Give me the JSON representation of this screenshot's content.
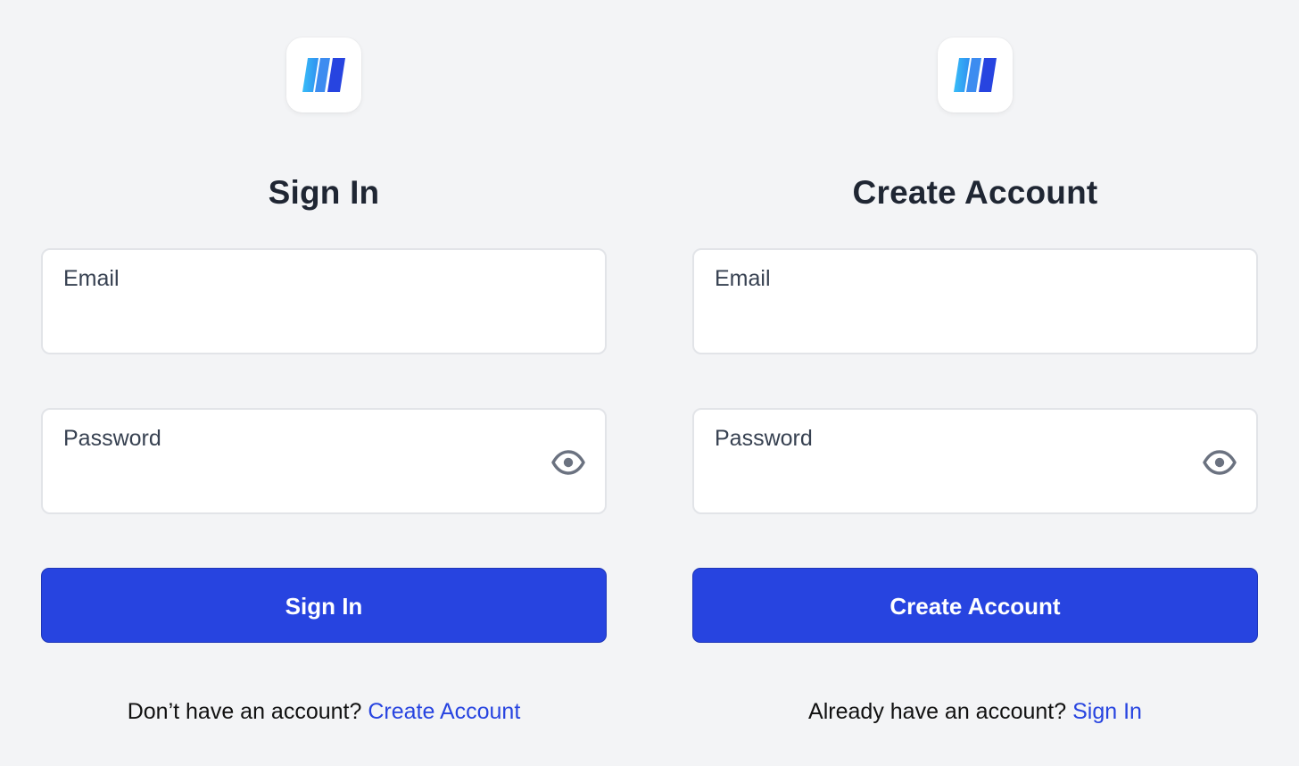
{
  "brand": {
    "accent_color": "#2744e0",
    "logo_icon": "three-slanted-bars-logo"
  },
  "sign_in": {
    "title": "Sign In",
    "email_label": "Email",
    "email_value": "",
    "password_label": "Password",
    "password_value": "",
    "password_toggle_icon": "eye-icon",
    "submit_label": "Sign In",
    "footer_text": "Don’t have an account?",
    "footer_link": "Create Account"
  },
  "create_account": {
    "title": "Create Account",
    "email_label": "Email",
    "email_value": "",
    "password_label": "Password",
    "password_value": "",
    "password_toggle_icon": "eye-icon",
    "submit_label": "Create Account",
    "footer_text": "Already have an account?",
    "footer_link": "Sign In"
  }
}
